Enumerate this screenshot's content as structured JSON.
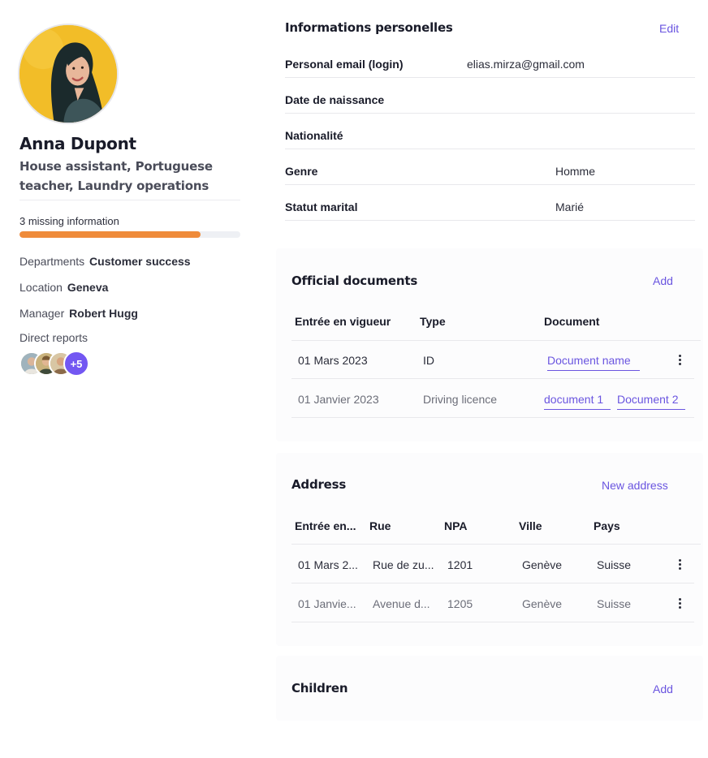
{
  "profile": {
    "name": "Anna Dupont",
    "job_title": "House assistant, Portuguese teacher, Laundry operations",
    "missing_info": "3 missing information",
    "missing_progress": 0.82,
    "departments_label": "Departments",
    "departments_value": "Customer success",
    "location_label": "Location",
    "location_value": "Geneva",
    "manager_label": "Manager",
    "manager_value": "Robert Hugg",
    "direct_reports_label": "Direct reports",
    "direct_reports_more": "+5"
  },
  "personal": {
    "title": "Informations personelles",
    "edit_label": "Edit",
    "rows": [
      {
        "label": "Personal email (login)",
        "value": "elias.mirza@gmail.com"
      },
      {
        "label": "Date de naissance",
        "value": ""
      },
      {
        "label": "Nationalité",
        "value": ""
      },
      {
        "label": "Genre",
        "value": "Homme"
      },
      {
        "label": "Statut marital",
        "value": "Marié"
      }
    ]
  },
  "documents": {
    "title": "Official documents",
    "add_label": "Add",
    "headers": [
      "Entrée en vigueur",
      "Type",
      "Document"
    ],
    "rows": [
      {
        "date": "01 Mars 2023",
        "type": "ID",
        "docs": [
          "Document name"
        ]
      },
      {
        "date": "01 Janvier 2023",
        "type": "Driving licence",
        "docs": [
          "document 1",
          "Document 2"
        ]
      }
    ]
  },
  "address": {
    "title": "Address",
    "new_label": "New address",
    "headers": [
      "Entrée en...",
      "Rue",
      "NPA",
      "Ville",
      "Pays"
    ],
    "rows": [
      {
        "date": "01 Mars 2...",
        "rue": "Rue de zu...",
        "npa": "1201",
        "ville": "Genève",
        "pays": "Suisse"
      },
      {
        "date": "01 Janvie...",
        "rue": "Avenue d...",
        "npa": "1205",
        "ville": "Genève",
        "pays": "Suisse"
      }
    ]
  },
  "children": {
    "title": "Children",
    "add_label": "Add"
  },
  "colors": {
    "accent": "#6a55e0",
    "progress": "#ef8b3a",
    "avatar_bg": "#f2bd28",
    "badge": "#7357f2"
  }
}
